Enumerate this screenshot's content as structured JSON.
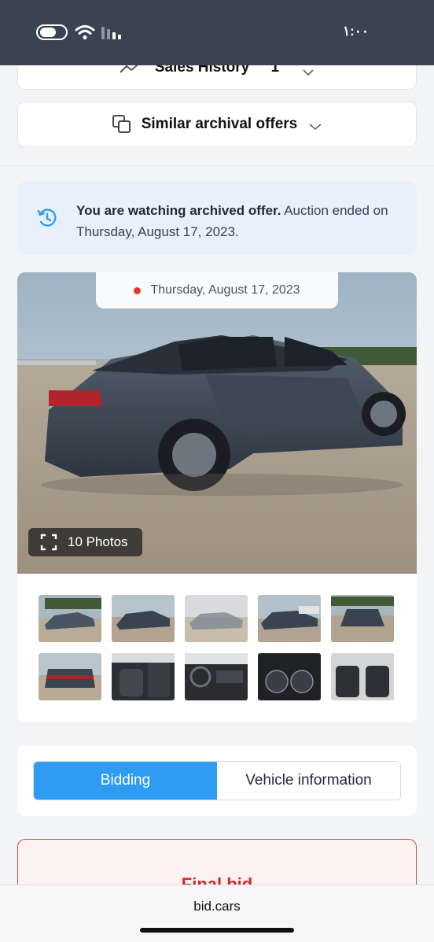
{
  "status_bar": {
    "time": "١:٠٠",
    "icons": [
      "toggle-icon",
      "wifi-icon",
      "signal-icon"
    ]
  },
  "sales_history": {
    "label": "Sales History",
    "count": "1"
  },
  "similar": {
    "label": "Similar archival offers"
  },
  "archived_notice": {
    "bold_text": "You are watching archived offer.",
    "text": " Auction ended on Thursday, August 17, 2023."
  },
  "gallery": {
    "date": "Thursday, August 17, 2023",
    "photos_label": "10 Photos",
    "thumbnail_count": 10
  },
  "tabs": [
    {
      "label": "Bidding",
      "active": true
    },
    {
      "label": "Vehicle information",
      "active": false
    }
  ],
  "final_bid": {
    "label": "Final bid"
  },
  "browser": {
    "url": "bid.cars"
  },
  "colors": {
    "accent": "#2f9cf4",
    "notice_bg": "#e7f1fb",
    "alert_red": "#d0272b",
    "status_bar": "#3a4350"
  }
}
